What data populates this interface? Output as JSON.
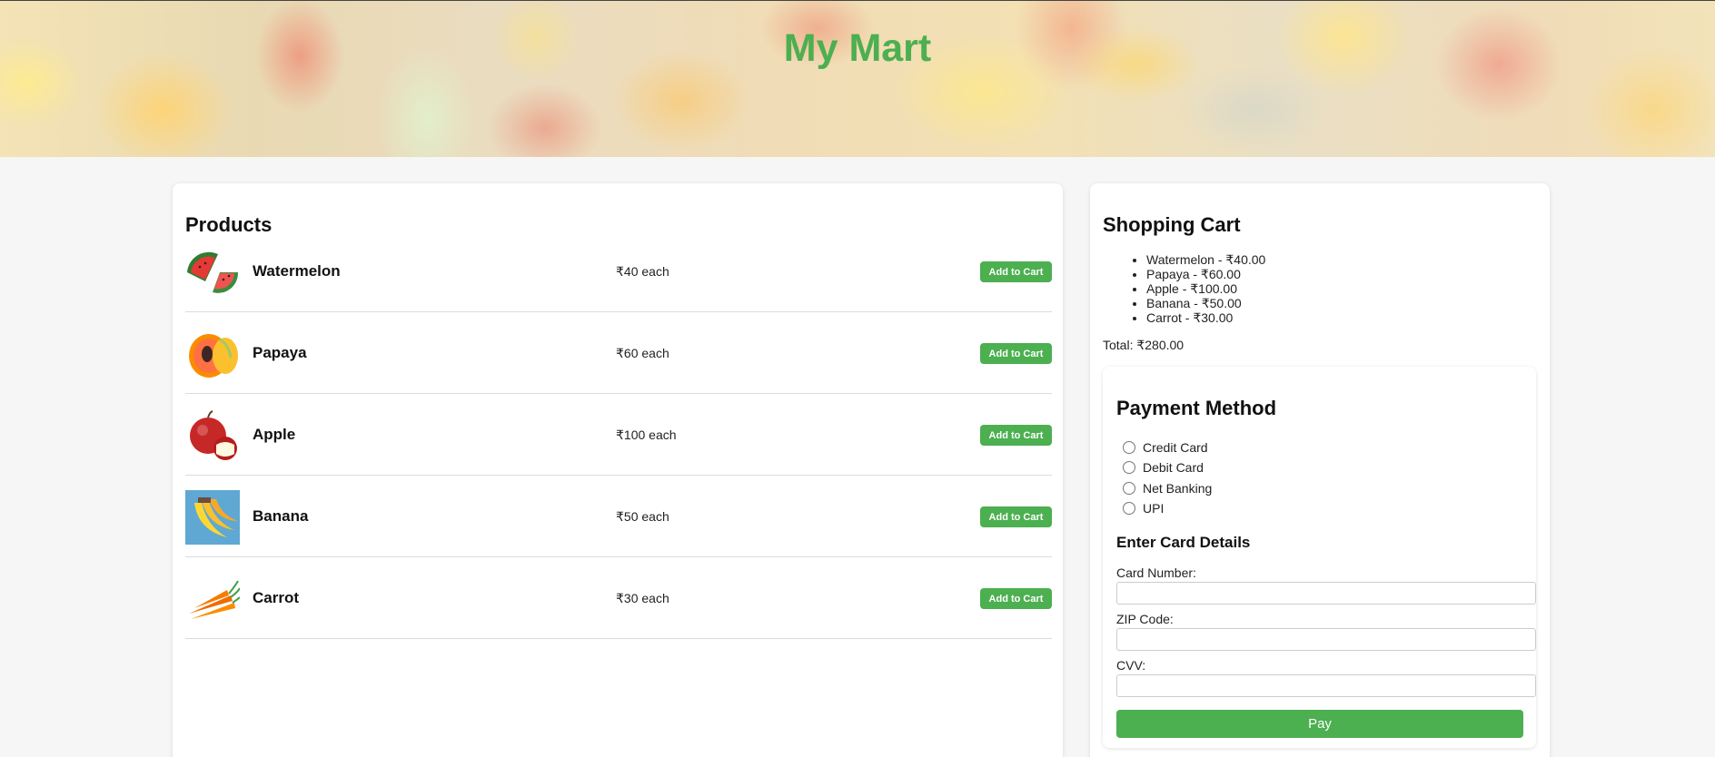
{
  "header": {
    "title": "My Mart"
  },
  "products": {
    "title": "Products",
    "add_label": "Add to Cart",
    "items": [
      {
        "name": "Watermelon",
        "currency": "₹",
        "price": "40",
        "unit": "each",
        "icon": "watermelon-icon"
      },
      {
        "name": "Papaya",
        "currency": "₹",
        "price": "60",
        "unit": "each",
        "icon": "papaya-icon"
      },
      {
        "name": "Apple",
        "currency": "₹",
        "price": "100",
        "unit": "each",
        "icon": "apple-icon"
      },
      {
        "name": "Banana",
        "currency": "₹",
        "price": "50",
        "unit": "each",
        "icon": "banana-icon"
      },
      {
        "name": "Carrot",
        "currency": "₹",
        "price": "30",
        "unit": "each",
        "icon": "carrot-icon"
      }
    ]
  },
  "cart": {
    "title": "Shopping Cart",
    "items": [
      "Watermelon - ₹40.00",
      "Papaya - ₹60.00",
      "Apple - ₹100.00",
      "Banana - ₹50.00",
      "Carrot - ₹30.00"
    ],
    "total": "Total: ₹280.00"
  },
  "payment": {
    "title": "Payment Method",
    "options": [
      "Credit Card",
      "Debit Card",
      "Net Banking",
      "UPI"
    ],
    "card_heading": "Enter Card Details",
    "fields": [
      {
        "label": "Card Number:",
        "value": ""
      },
      {
        "label": "ZIP Code:",
        "value": ""
      },
      {
        "label": "CVV:",
        "value": ""
      }
    ],
    "pay_label": "Pay"
  },
  "colors": {
    "accent": "#4caf50",
    "background": "#f6f6f6",
    "panel": "#ffffff"
  }
}
